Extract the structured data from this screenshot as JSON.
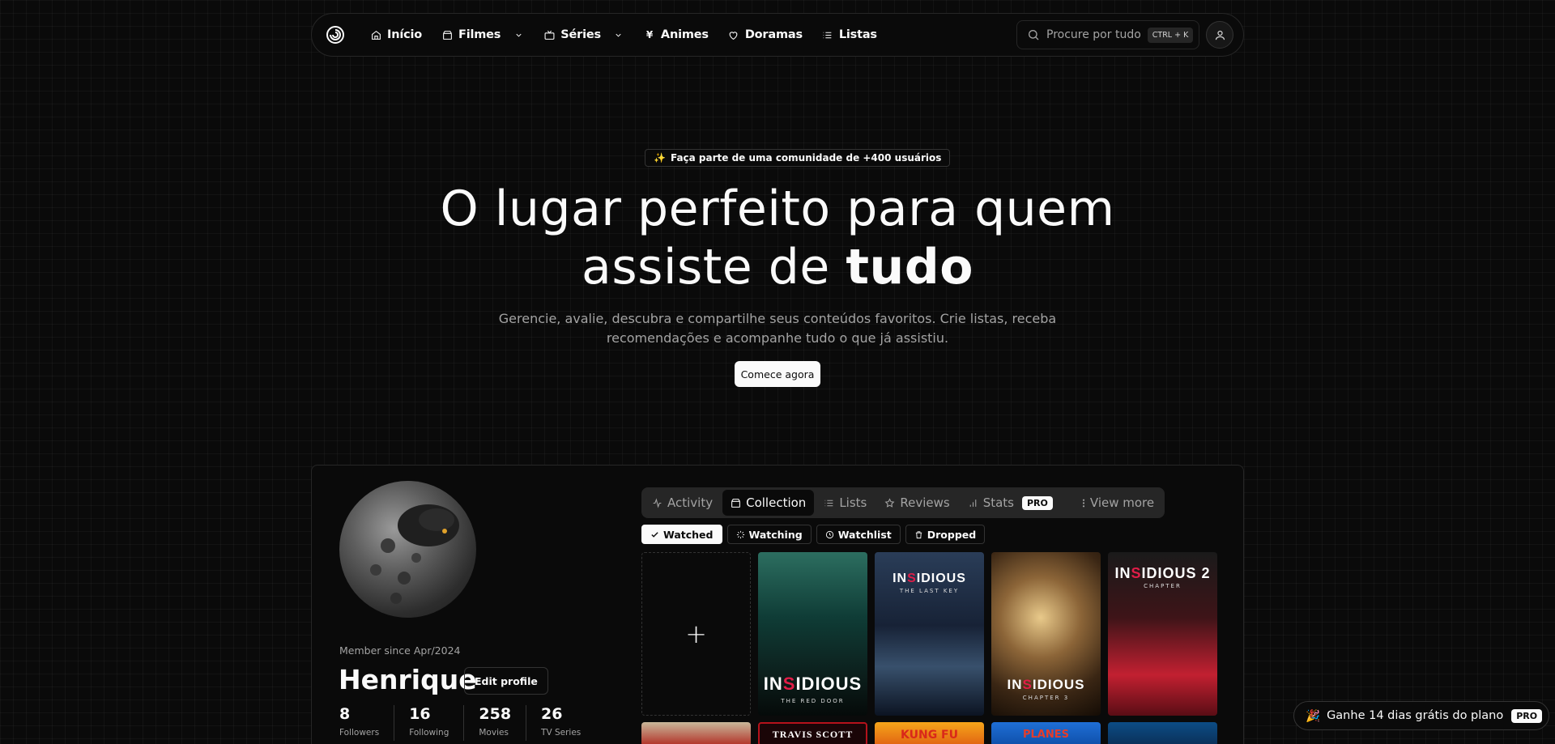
{
  "nav": {
    "items": [
      {
        "label": "Início",
        "icon": "home-icon"
      },
      {
        "label": "Filmes",
        "icon": "clapperboard-icon",
        "dropdown": true
      },
      {
        "label": "Séries",
        "icon": "tv-icon",
        "dropdown": true
      },
      {
        "label": "Animes",
        "icon": "yen-icon"
      },
      {
        "label": "Doramas",
        "icon": "heart-icon"
      },
      {
        "label": "Listas",
        "icon": "list-icon"
      }
    ],
    "search_placeholder": "Procure por tudo",
    "search_shortcut": "CTRL + K"
  },
  "hero": {
    "badge_emoji": "✨",
    "badge": "Faça parte de uma comunidade de +400 usuários",
    "title_line1": "O lugar perfeito para quem",
    "title_line2_prefix": "assiste de ",
    "title_line2_bold": "tudo",
    "subtitle": "Gerencie, avalie, descubra e compartilhe seus conteúdos favoritos. Crie listas, receba recomendações e acompanhe tudo o que já assistiu.",
    "cta": "Comece agora"
  },
  "profile": {
    "member_since": "Member since Apr/2024",
    "name": "Henrique",
    "edit_label": "Edit profile",
    "stats": [
      {
        "value": "8",
        "label": "Followers"
      },
      {
        "value": "16",
        "label": "Following"
      },
      {
        "value": "258",
        "label": "Movies"
      },
      {
        "value": "26",
        "label": "TV Series"
      }
    ],
    "tabs": [
      {
        "label": "Activity",
        "icon": "activity-icon"
      },
      {
        "label": "Collection",
        "icon": "collection-icon",
        "active": true
      },
      {
        "label": "Lists",
        "icon": "list-icon"
      },
      {
        "label": "Reviews",
        "icon": "star-icon"
      },
      {
        "label": "Stats",
        "icon": "bar-chart-icon",
        "badge": "PRO"
      },
      {
        "label": "View more",
        "icon": "more-vertical-icon"
      }
    ],
    "filters": [
      {
        "label": "Watched",
        "icon": "check-icon",
        "active": true
      },
      {
        "label": "Watching",
        "icon": "loader-icon"
      },
      {
        "label": "Watchlist",
        "icon": "clock-icon"
      },
      {
        "label": "Dropped",
        "icon": "trash-icon"
      }
    ],
    "add_symbol": "+",
    "posters": [
      {
        "title_a": "IN",
        "title_r": "S",
        "title_b": "IDIOUS",
        "subtitle": "THE RED DOOR"
      },
      {
        "title_a": "IN",
        "title_r": "S",
        "title_b": "IDIOUS",
        "subtitle": "THE LAST KEY"
      },
      {
        "title_a": "IN",
        "title_r": "S",
        "title_b": "IDIOUS",
        "subtitle": "CHAPTER 3"
      },
      {
        "title_a": "IN",
        "title_r": "S",
        "title_b": "IDIOUS 2",
        "subtitle": "CHAPTER"
      }
    ],
    "posters_row2": [
      "",
      "TRAVIS SCOTT",
      "KUNG FU",
      "PLANES",
      ""
    ]
  },
  "promo": {
    "emoji": "🎉",
    "text": "Ganhe 14 dias grátis do plano",
    "badge": "PRO"
  }
}
